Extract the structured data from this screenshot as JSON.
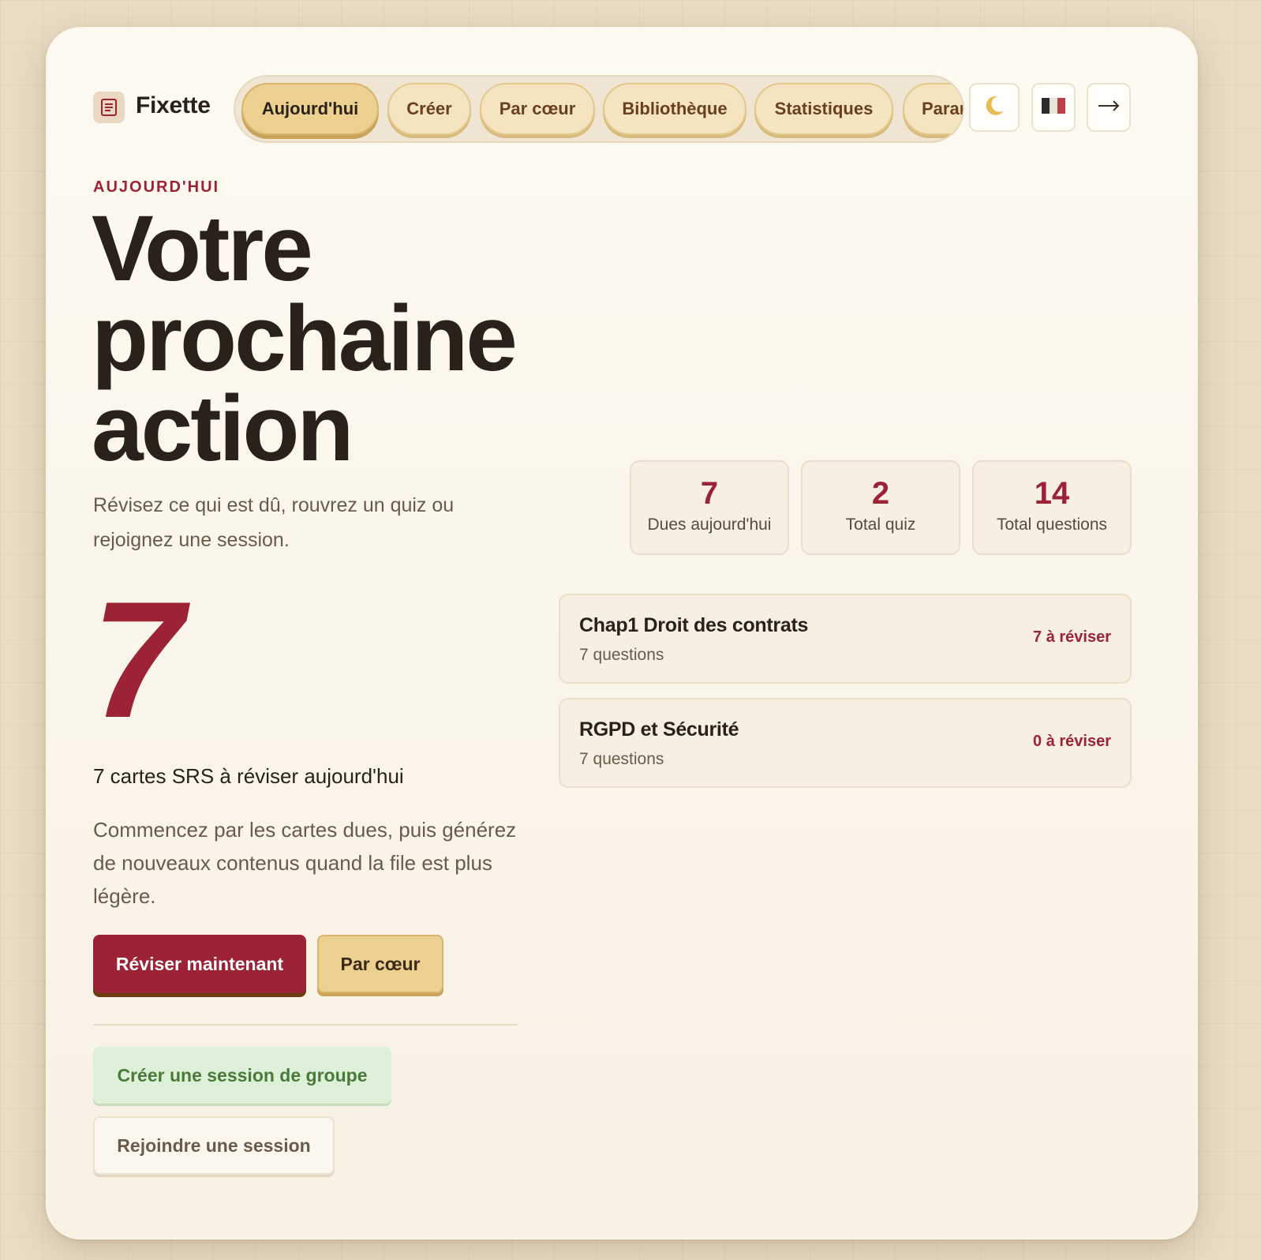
{
  "brand": {
    "name": "Fixette",
    "icon": "notebook-icon"
  },
  "nav": {
    "tabs": [
      {
        "label": "Aujourd'hui",
        "active": true
      },
      {
        "label": "Créer",
        "active": false
      },
      {
        "label": "Par cœur",
        "active": false
      },
      {
        "label": "Bibliothèque",
        "active": false
      },
      {
        "label": "Statistiques",
        "active": false
      },
      {
        "label": "Paramètres",
        "active": false
      }
    ],
    "theme_icon": "moon-icon",
    "language_icon": "french-flag-icon",
    "logout_icon": "arrow-right-icon"
  },
  "hero": {
    "eyebrow": "AUJOURD'HUI",
    "title_line1": "Votre",
    "title_line2": "prochaine",
    "title_line3": "action",
    "subtitle": "Révisez ce qui est dû, rouvrez un quiz ou rejoignez une session."
  },
  "stats": [
    {
      "value": "7",
      "label": "Dues aujourd'hui"
    },
    {
      "value": "2",
      "label": "Total quiz"
    },
    {
      "value": "14",
      "label": "Total questions"
    }
  ],
  "focus": {
    "big_number": "7",
    "due_line": "7 cartes SRS à réviser aujourd'hui",
    "description": "Commencez par les cartes dues, puis générez de nouveaux contenus quand la file est plus légère."
  },
  "actions": {
    "review_now": "Réviser maintenant",
    "by_heart": "Par cœur",
    "create_group": "Créer une session de groupe",
    "join_session": "Rejoindre une session"
  },
  "quizzes": [
    {
      "title": "Chap1 Droit des contrats",
      "questions": "7 questions",
      "due": "7 à réviser"
    },
    {
      "title": "RGPD et Sécurité",
      "questions": "7 questions",
      "due": "0 à réviser"
    }
  ],
  "colors": {
    "accent": "#9b2335",
    "gold": "#ecd08f",
    "ink": "#2a211b",
    "green": "#4a7a3a"
  }
}
